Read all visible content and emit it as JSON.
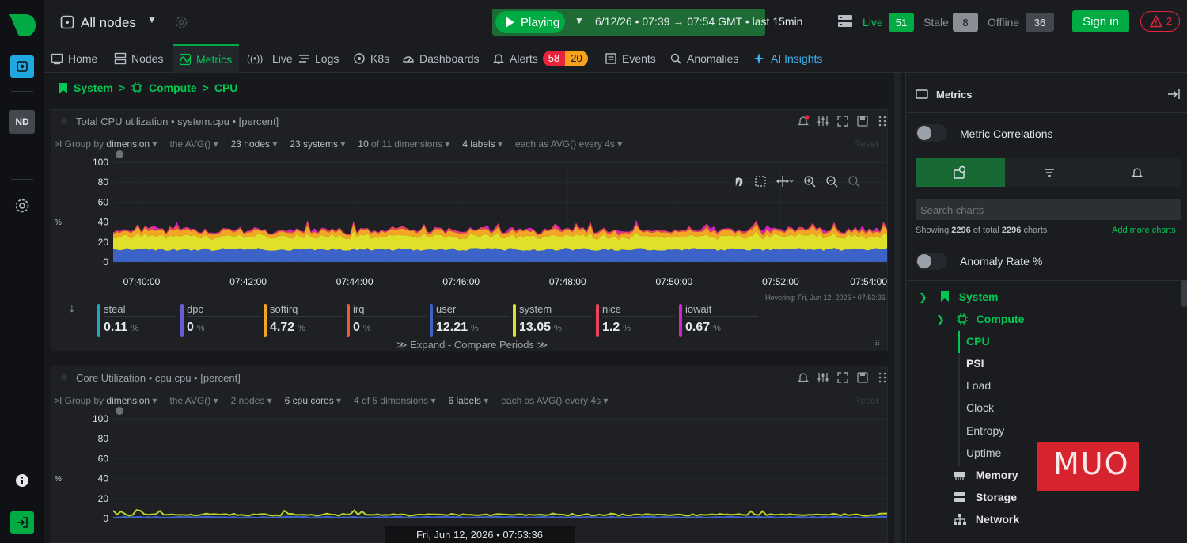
{
  "colors": {
    "accent": "#00ab44",
    "accent_text": "#00c853",
    "alert_red": "#e8243c",
    "alert_orange": "#f7a21b",
    "bg": "#1c1e22"
  },
  "rail": {
    "user_initials": "ND"
  },
  "topbar": {
    "room": "All nodes",
    "play_label": "Playing",
    "time_range": "6/12/26 • 07:39 → 07:54 GMT • last  15min",
    "live_label": "Live",
    "live_count": "51",
    "stale_label": "Stale",
    "stale_count": "8",
    "offline_label": "Offline",
    "offline_count": "36",
    "signin_label": "Sign in",
    "alerts_count": "2"
  },
  "tabs": [
    {
      "label": "Home",
      "icon": "home-icon"
    },
    {
      "label": "Nodes",
      "icon": "nodes-icon"
    },
    {
      "label": "Metrics",
      "icon": "metrics-icon"
    },
    {
      "label": "Live",
      "icon": "live-icon"
    },
    {
      "label": "Logs",
      "icon": "logs-icon"
    },
    {
      "label": "K8s",
      "icon": "k8s-icon"
    },
    {
      "label": "Dashboards",
      "icon": "dashboards-icon"
    },
    {
      "label": "Alerts",
      "icon": "bell-icon",
      "critical": "58",
      "warning": "20"
    },
    {
      "label": "Events",
      "icon": "events-icon"
    },
    {
      "label": "Anomalies",
      "icon": "anomalies-icon"
    },
    {
      "label": "AI Insights",
      "icon": "sparkle-icon"
    }
  ],
  "breadcrumb": [
    "System",
    ">",
    "Compute",
    ">",
    "CPU"
  ],
  "chart1": {
    "title": "Total CPU utilization • system.cpu • [percent]",
    "group_by_prefix": ">I Group by",
    "group_by": "dimension",
    "agg": "the AVG()",
    "nodes": "23 nodes",
    "systems": "23 systems",
    "dims_a": "10",
    "dims_b": "of 11 dimensions",
    "labels": "4 labels",
    "each": "each as AVG() every 4s",
    "reset": "Reset",
    "yaxis_unit": "%",
    "hover_text": "Hovering: Fri, Jun 12, 2026 • 07:53:36",
    "expand": "Expand - Compare Periods"
  },
  "chart2": {
    "title": "Core Utilization • cpu.cpu • [percent]",
    "group_by_prefix": ">I Group by",
    "group_by": "dimension",
    "agg": "the AVG()",
    "nodes": "2 nodes",
    "cores": "6 cpu cores",
    "dims": "4 of 5 dimensions",
    "labels": "6 labels",
    "each": "each as AVG() every 4s",
    "reset": "Reset",
    "yaxis_unit": "%"
  },
  "footer_time": "Fri, Jun 12, 2026 • 07:53:36",
  "chart_data": [
    {
      "type": "area",
      "title": "Total CPU utilization • system.cpu • [percent]",
      "ylabel": "%",
      "ylim": [
        0,
        100
      ],
      "y_ticks": [
        "100",
        "80",
        "60",
        "40",
        "20",
        "0"
      ],
      "x_ticks": [
        "07:40:00",
        "07:42:00",
        "07:44:00",
        "07:46:00",
        "07:48:00",
        "07:50:00",
        "07:52:00",
        "07:54:00"
      ],
      "stacked": true,
      "grid": true,
      "series": [
        {
          "name": "steal",
          "value": "0.11",
          "color": "#21a4c4"
        },
        {
          "name": "dpc",
          "value": "0",
          "color": "#6b5bd6"
        },
        {
          "name": "softirq",
          "value": "4.72",
          "color": "#f2a623"
        },
        {
          "name": "irq",
          "value": "0",
          "color": "#ec5a2d"
        },
        {
          "name": "user",
          "value": "12.21",
          "color": "#3d63c9"
        },
        {
          "name": "system",
          "value": "13.05",
          "color": "#dfe02a"
        },
        {
          "name": "nice",
          "value": "1.2",
          "color": "#e8455c"
        },
        {
          "name": "iowait",
          "value": "0.67",
          "color": "#d722c5"
        }
      ]
    },
    {
      "type": "area",
      "title": "Core Utilization • cpu.cpu • [percent]",
      "ylabel": "%",
      "ylim": [
        0,
        100
      ],
      "y_ticks": [
        "100",
        "80",
        "60",
        "40",
        "20",
        "0"
      ],
      "grid": true
    }
  ],
  "panel": {
    "title": "Metrics",
    "metric_correlations": "Metric Correlations",
    "search_placeholder": "Search charts",
    "showing_prefix": "Showing",
    "showing_count": "2296",
    "showing_mid": "of total",
    "showing_total": "2296",
    "showing_suffix": "charts",
    "add_more": "Add more charts",
    "anomaly_rate": "Anomaly Rate %",
    "tree": {
      "system": "System",
      "compute": "Compute",
      "cpu": "CPU",
      "psi": "PSI",
      "load": "Load",
      "clock": "Clock",
      "entropy": "Entropy",
      "uptime": "Uptime",
      "memory": "Memory",
      "storage": "Storage",
      "network": "Network"
    }
  },
  "watermark": "MUO"
}
